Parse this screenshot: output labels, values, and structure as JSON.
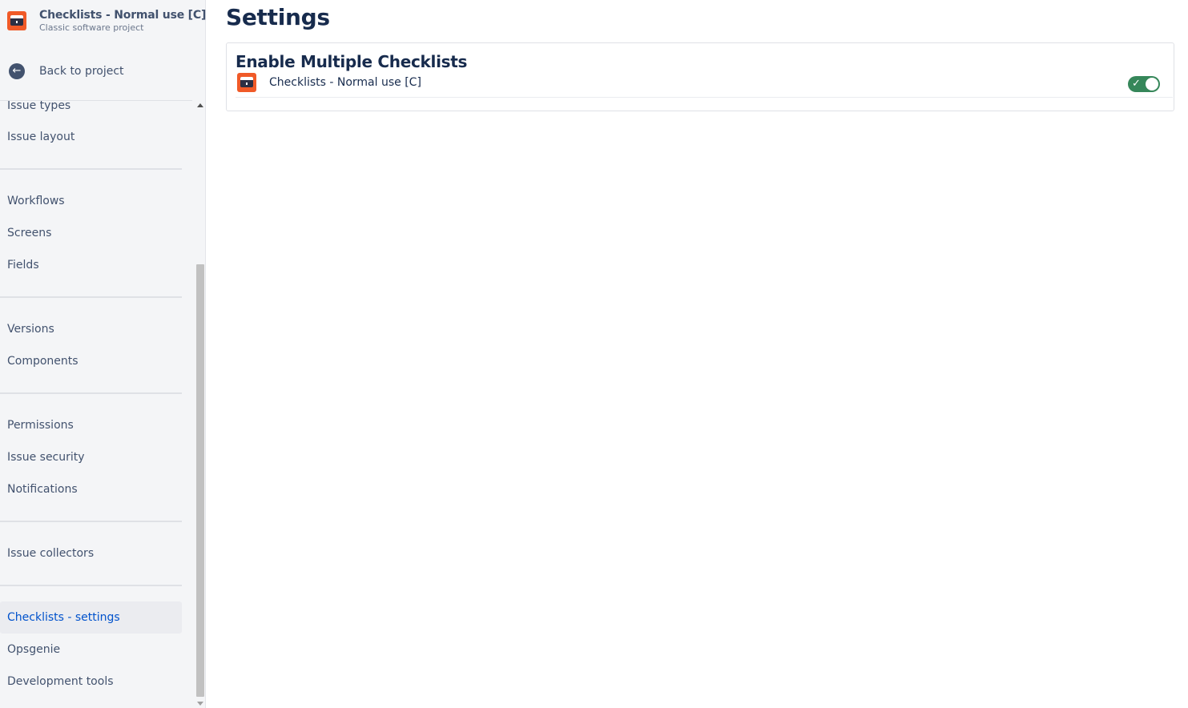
{
  "project": {
    "name": "Checklists - Normal use [C]",
    "type": "Classic software project",
    "avatar_icon": "project-window-icon",
    "avatar_color": "#f05a28"
  },
  "sidebar": {
    "back_label": "Back to project",
    "back_icon": "arrow-left-circle-icon",
    "items": [
      {
        "label": "Issue types",
        "active": false
      },
      {
        "label": "Issue layout",
        "active": false
      },
      {
        "label": "Workflows",
        "active": false
      },
      {
        "label": "Screens",
        "active": false
      },
      {
        "label": "Fields",
        "active": false
      },
      {
        "label": "Versions",
        "active": false
      },
      {
        "label": "Components",
        "active": false
      },
      {
        "label": "Permissions",
        "active": false
      },
      {
        "label": "Issue security",
        "active": false
      },
      {
        "label": "Notifications",
        "active": false
      },
      {
        "label": "Issue collectors",
        "active": false
      },
      {
        "label": "Checklists - settings",
        "active": true
      },
      {
        "label": "Opsgenie",
        "active": false
      },
      {
        "label": "Development tools",
        "active": false
      }
    ]
  },
  "main": {
    "title": "Settings",
    "card": {
      "title": "Enable Multiple Checklists",
      "rows": [
        {
          "label": "Checklists - Normal use [C]",
          "enabled": true,
          "toggle_color": "#36875a"
        }
      ]
    }
  },
  "colors": {
    "accent": "#0052cc",
    "sidebar_bg": "#f4f5f7",
    "text_primary": "#172b4d",
    "text_secondary": "#42526e"
  }
}
